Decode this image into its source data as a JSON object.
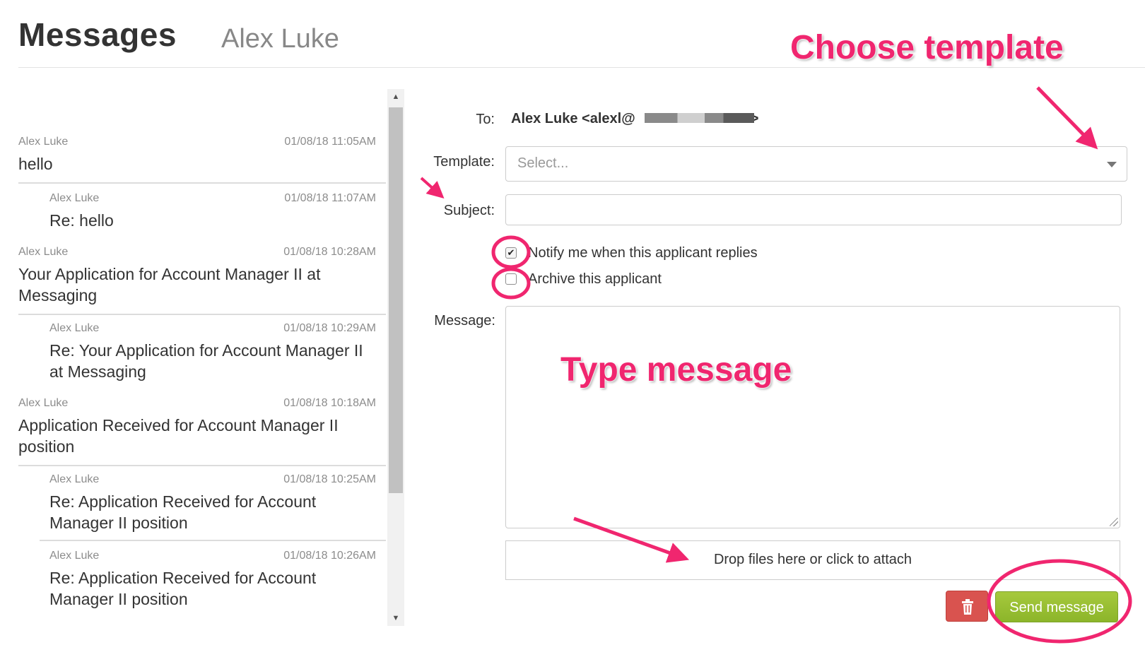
{
  "header": {
    "title": "Messages",
    "subtitle": "Alex Luke"
  },
  "messages": [
    {
      "sender": "Alex Luke",
      "date": "01/08/18 11:05AM",
      "subject": "hello",
      "reply": false
    },
    {
      "sender": "Alex Luke",
      "date": "01/08/18 11:07AM",
      "subject": "Re: hello",
      "reply": true
    },
    {
      "sender": "Alex Luke",
      "date": "01/08/18 10:28AM",
      "subject": "Your Application for Account Manager II at Messaging",
      "reply": false
    },
    {
      "sender": "Alex Luke",
      "date": "01/08/18 10:29AM",
      "subject": "Re: Your Application for Account Manager II at Messaging",
      "reply": true
    },
    {
      "sender": "Alex Luke",
      "date": "01/08/18 10:18AM",
      "subject": "Application Received for Account Manager II position",
      "reply": false
    },
    {
      "sender": "Alex Luke",
      "date": "01/08/18 10:25AM",
      "subject": "Re: Application Received for Account Manager II position",
      "reply": true
    },
    {
      "sender": "Alex Luke",
      "date": "01/08/18 10:26AM",
      "subject": "Re: Application Received for Account Manager II position",
      "reply": true
    }
  ],
  "scrollbar": {
    "up_glyph": "▲",
    "down_glyph": "▼"
  },
  "form": {
    "to_label": "To:",
    "to_value": "Alex Luke <alexl@",
    "to_value_end": ">",
    "template_label": "Template:",
    "template_placeholder": "Select...",
    "subject_label": "Subject:",
    "subject_value": "",
    "notify_label": "Notify me when this applicant replies",
    "notify_checked": true,
    "archive_label": "Archive this applicant",
    "archive_checked": false,
    "message_label": "Message:",
    "message_value": "",
    "dropzone_label": "Drop files here or click to attach",
    "send_label": "Send message",
    "check_glyph": "✔"
  },
  "annotations": {
    "choose_template": "Choose template",
    "type_message": "Type message",
    "accent_color": "#f0266f"
  },
  "icons": {
    "delete": "trash-icon",
    "select_caret": "chevron-down-icon"
  }
}
